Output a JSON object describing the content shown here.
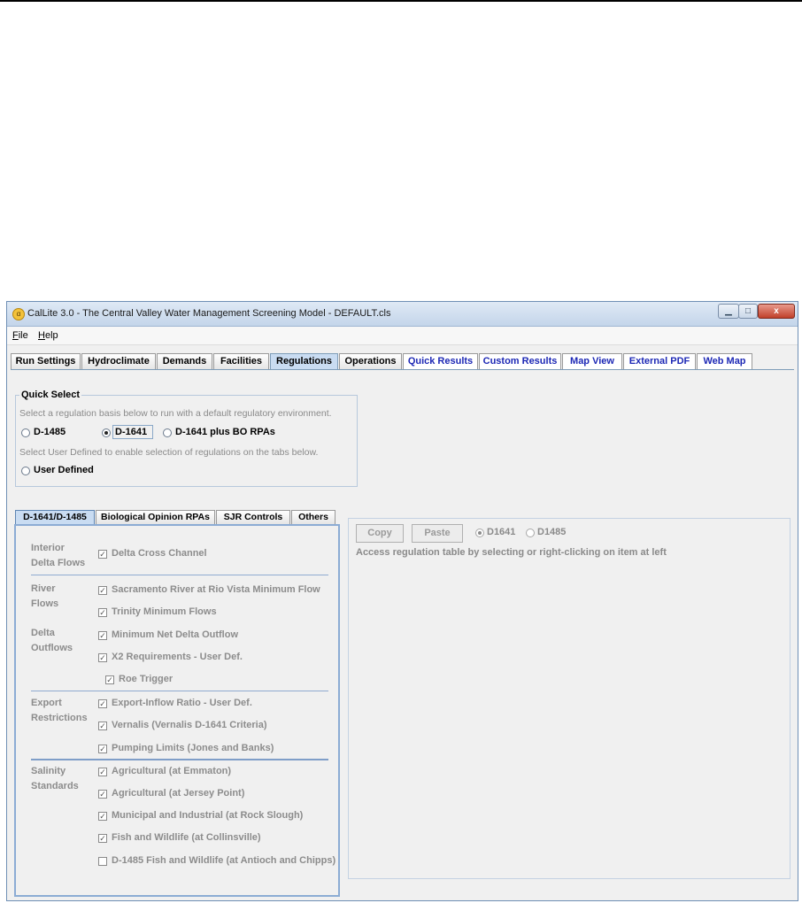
{
  "window": {
    "title": "CalLite 3.0 -  The Central Valley Water Management Screening Model - DEFAULT.cls",
    "icon": "app-icon",
    "controls": {
      "minimize": "minimize-icon",
      "maximize": "maximize-icon",
      "close_label": "x"
    }
  },
  "menu": {
    "items": [
      "File",
      "Help"
    ]
  },
  "tabs": [
    {
      "label": "Run Settings",
      "style": "normal"
    },
    {
      "label": "Hydroclimate",
      "style": "normal"
    },
    {
      "label": "Demands",
      "style": "normal"
    },
    {
      "label": "Facilities",
      "style": "normal"
    },
    {
      "label": "Regulations",
      "style": "active"
    },
    {
      "label": "Operations",
      "style": "normal"
    },
    {
      "label": "Quick Results",
      "style": "blue"
    },
    {
      "label": "Custom Results",
      "style": "blue"
    },
    {
      "label": "Map View",
      "style": "blue"
    },
    {
      "label": "External PDF",
      "style": "blue"
    },
    {
      "label": "Web Map",
      "style": "blue"
    }
  ],
  "quick_select": {
    "title": "Quick Select",
    "hint1": "Select a regulation basis below to run with a default regulatory environment.",
    "options": [
      "D-1485",
      "D-1641",
      "D-1641 plus BO RPAs"
    ],
    "selected": "D-1641",
    "hint2": "Select User Defined to enable selection of regulations on the tabs below.",
    "user_defined": "User Defined"
  },
  "subtabs": [
    "D-1641/D-1485",
    "Biological Opinion RPAs",
    "SJR Controls",
    "Others"
  ],
  "groups": [
    {
      "label": [
        "Interior",
        "Delta Flows"
      ]
    },
    {
      "label": [
        "River",
        "Flows"
      ]
    },
    {
      "label": [
        "Delta",
        "Outflows"
      ]
    },
    {
      "label": [
        "Export",
        "Restrictions"
      ]
    },
    {
      "label": [
        "Salinity",
        "Standards"
      ]
    }
  ],
  "checkboxes": [
    {
      "label": "Delta Cross Channel",
      "checked": true
    },
    {
      "label": "Sacramento River at Rio Vista Minimum Flow",
      "checked": true
    },
    {
      "label": "Trinity Minimum Flows",
      "checked": true
    },
    {
      "label": "Minimum Net Delta Outflow",
      "checked": true
    },
    {
      "label": "X2 Requirements - User Def.",
      "checked": true
    },
    {
      "label": "Roe Trigger",
      "checked": true
    },
    {
      "label": "Export-Inflow Ratio - User Def.",
      "checked": true
    },
    {
      "label": "Vernalis (Vernalis D-1641 Criteria)",
      "checked": true
    },
    {
      "label": "Pumping Limits (Jones and Banks)",
      "checked": true
    },
    {
      "label": "Agricultural (at Emmaton)",
      "checked": true
    },
    {
      "label": "Agricultural (at Jersey Point)",
      "checked": true
    },
    {
      "label": "Municipal and Industrial (at Rock Slough)",
      "checked": true
    },
    {
      "label": " Fish and Wildlife (at Collinsville)",
      "checked": true
    },
    {
      "label": "D-1485 Fish and Wildlife (at Antioch and Chipps)",
      "checked": false
    }
  ],
  "right_panel": {
    "copy_label": "Copy",
    "paste_label": "Paste",
    "options": [
      "D1641",
      "D1485"
    ],
    "selected": "D1641",
    "info": "Access regulation table by selecting or right-clicking on item at left"
  }
}
